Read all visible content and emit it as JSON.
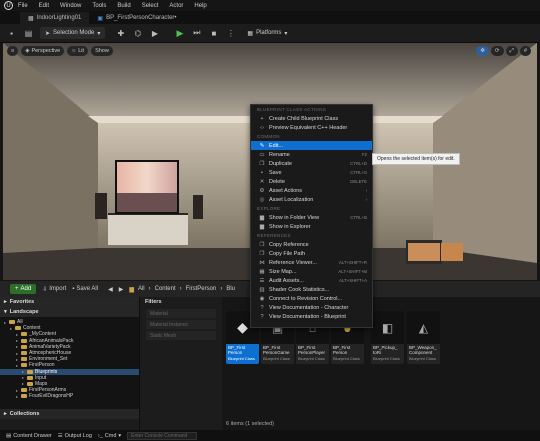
{
  "menubar": {
    "items": [
      "File",
      "Edit",
      "Window",
      "Tools",
      "Build",
      "Select",
      "Actor",
      "Help"
    ]
  },
  "tabs": [
    {
      "label": "IndoorLighting01"
    },
    {
      "label": "BP_FirstPersonCharacter•"
    }
  ],
  "toolbar": {
    "selection_mode": "Selection Mode",
    "platforms": "Platforms"
  },
  "viewport": {
    "perspective": "Perspective",
    "lit": "Lit",
    "show": "Show"
  },
  "context_menu": {
    "section1": "BLUEPRINT CLASS ACTIONS",
    "create_child": "Create Child Blueprint Class",
    "preview_cpp": "Preview Equivalent C++ Header",
    "section2": "COMMON",
    "edit": "Edit...",
    "rename": "Rename",
    "rename_sc": "F2",
    "duplicate": "Duplicate",
    "duplicate_sc": "CTRL+D",
    "save": "Save",
    "save_sc": "CTRL+S",
    "delete": "Delete",
    "delete_sc": "DELETE",
    "asset_actions": "Asset Actions",
    "asset_localization": "Asset Localization",
    "section3": "EXPLORE",
    "show_folder": "Show in Folder View",
    "show_folder_sc": "CTRL+B",
    "show_explorer": "Show in Explorer",
    "section4": "REFERENCES",
    "copy_ref": "Copy Reference",
    "copy_path": "Copy File Path",
    "ref_viewer": "Reference Viewer...",
    "ref_viewer_sc": "ALT+SHIFT+R",
    "size_map": "Size Map...",
    "size_map_sc": "ALT+SHIFT+M",
    "audit": "Audit Assets...",
    "audit_sc": "ALT+SHIFT+A",
    "shader": "Shader Cook Statistics...",
    "revision": "Connect to Revision Control...",
    "doc_char": "View Documentation - Character",
    "doc_bp": "View Documentation - Blueprint"
  },
  "tooltip": "Opens the selected item(s) for edit.",
  "content_browser": {
    "add": "Add",
    "import": "Import",
    "save_all": "Save All",
    "breadcrumb": [
      "All",
      "Content",
      "FirstPerson",
      "Blu"
    ],
    "favorites": "Favorites",
    "landscape": "Landscape",
    "collections": "Collections",
    "filters": "Filters",
    "filter_items": [
      "Material",
      "Material Instance",
      "Static Mesh"
    ],
    "tree": [
      {
        "label": "All",
        "depth": 0
      },
      {
        "label": "Content",
        "depth": 1
      },
      {
        "label": "_MyContent",
        "depth": 2
      },
      {
        "label": "AfricanAnimalsPack",
        "depth": 2
      },
      {
        "label": "AnimalVarietyPack",
        "depth": 2
      },
      {
        "label": "AtmosphericHouse",
        "depth": 2
      },
      {
        "label": "Environment_Set",
        "depth": 2
      },
      {
        "label": "FirstPerson",
        "depth": 2
      },
      {
        "label": "Blueprints",
        "depth": 3,
        "selected": true
      },
      {
        "label": "Input",
        "depth": 3
      },
      {
        "label": "Maps",
        "depth": 3
      },
      {
        "label": "FirstPersonArms",
        "depth": 2
      },
      {
        "label": "FourEvilDragonsHP",
        "depth": 2
      }
    ],
    "assets": [
      {
        "name": "BP_First Person",
        "type": "Blueprint Class",
        "selected": true
      },
      {
        "name": "BP_First PersonGame",
        "type": "Blueprint Class"
      },
      {
        "name": "BP_First PersonPlayer",
        "type": "Blueprint Class"
      },
      {
        "name": "BP_First Person",
        "type": "Blueprint Class"
      },
      {
        "name": "BP_Pickup_ toRi",
        "type": "Blueprint Class"
      },
      {
        "name": "BP_Weapon_ Component",
        "type": "Blueprint Class"
      }
    ],
    "status": "6 items (1 selected)"
  },
  "statusbar": {
    "content_drawer": "Content Drawer",
    "output_log": "Output Log",
    "cmd": "Cmd",
    "cmd_placeholder": "Enter Console Command"
  }
}
